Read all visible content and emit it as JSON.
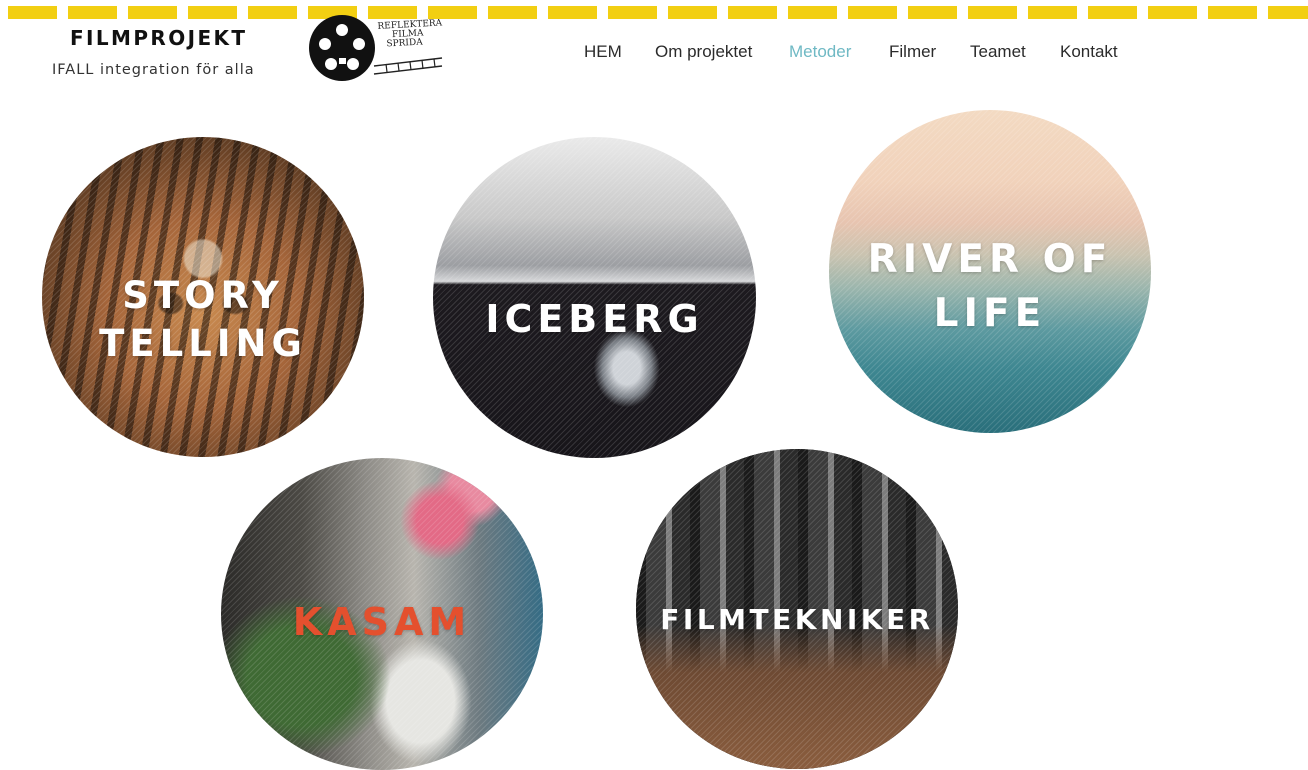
{
  "brand": {
    "title": "FILMPROJEKT",
    "tagline": "IFALL integration för alla",
    "logo_lines": [
      "REFLEKTERA",
      "FILMA",
      "SPRIDA"
    ]
  },
  "nav": {
    "items": [
      {
        "label": "HEM",
        "active": false
      },
      {
        "label": "Om projektet",
        "active": false
      },
      {
        "label": "Metoder",
        "active": true
      },
      {
        "label": "Filmer",
        "active": false
      },
      {
        "label": "Teamet",
        "active": false
      },
      {
        "label": "Kontakt",
        "active": false
      }
    ],
    "active_color": "#6fb9c4"
  },
  "tiles": {
    "story": {
      "line1": "STORY",
      "line2": "TELLING",
      "image": "tiger"
    },
    "iceberg": {
      "line1": "ICEBERG",
      "image": "icicle"
    },
    "river": {
      "line1": "RIVER OF",
      "line2": "LIFE",
      "image": "sky-and-sea"
    },
    "kasam": {
      "line1": "KASAM",
      "image": "watering-plants",
      "label_color": "#e4502e"
    },
    "film": {
      "line1": "FILMTEKNIKER",
      "image": "corridor-camera"
    }
  },
  "colors": {
    "accent_yellow": "#f2cf12"
  }
}
